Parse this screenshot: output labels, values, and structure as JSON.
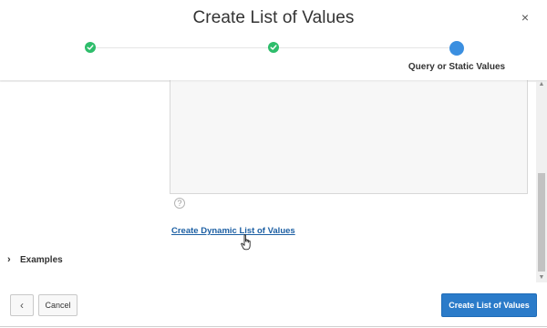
{
  "dialog": {
    "title": "Create List of Values",
    "close_glyph": "×"
  },
  "wizard": {
    "steps": [
      {
        "status": "complete",
        "icon": "check-icon"
      },
      {
        "status": "complete",
        "icon": "check-icon"
      },
      {
        "status": "current",
        "label": "Query or Static Values"
      }
    ],
    "colors": {
      "complete": "#2ebd6b",
      "current": "#3b8fe0"
    }
  },
  "body": {
    "help_glyph": "?",
    "dynamic_link": "Create Dynamic List of Values",
    "examples_label": "Examples",
    "examples_chevron": "›"
  },
  "footer": {
    "back_glyph": "‹",
    "cancel_label": "Cancel",
    "create_label": "Create List of Values",
    "primary_color": "#2b7bc9"
  },
  "scrollbar": {
    "up_glyph": "▲",
    "down_glyph": "▼"
  }
}
